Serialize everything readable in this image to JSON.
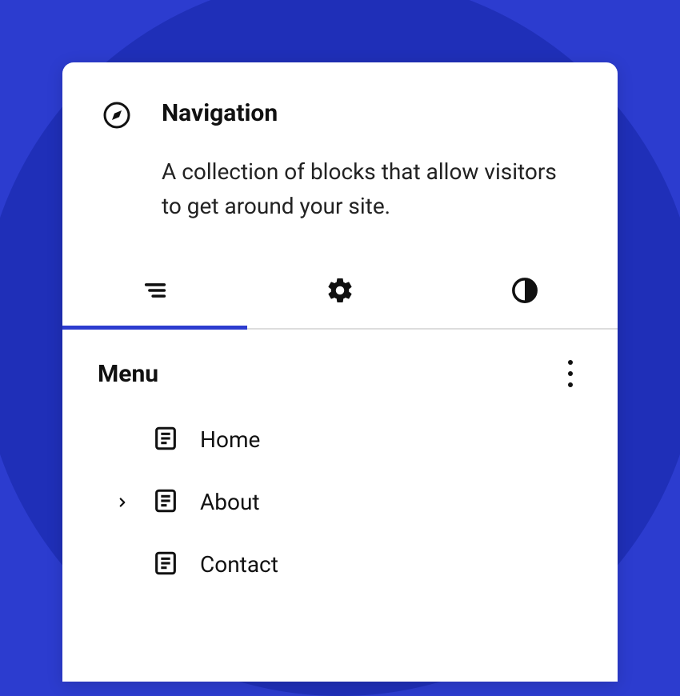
{
  "header": {
    "title": "Navigation",
    "description": "A collection of blocks that allow visitors to get around your site."
  },
  "menu": {
    "title": "Menu",
    "items": [
      {
        "label": "Home",
        "has_children": false
      },
      {
        "label": "About",
        "has_children": true
      },
      {
        "label": "Contact",
        "has_children": false
      }
    ]
  }
}
